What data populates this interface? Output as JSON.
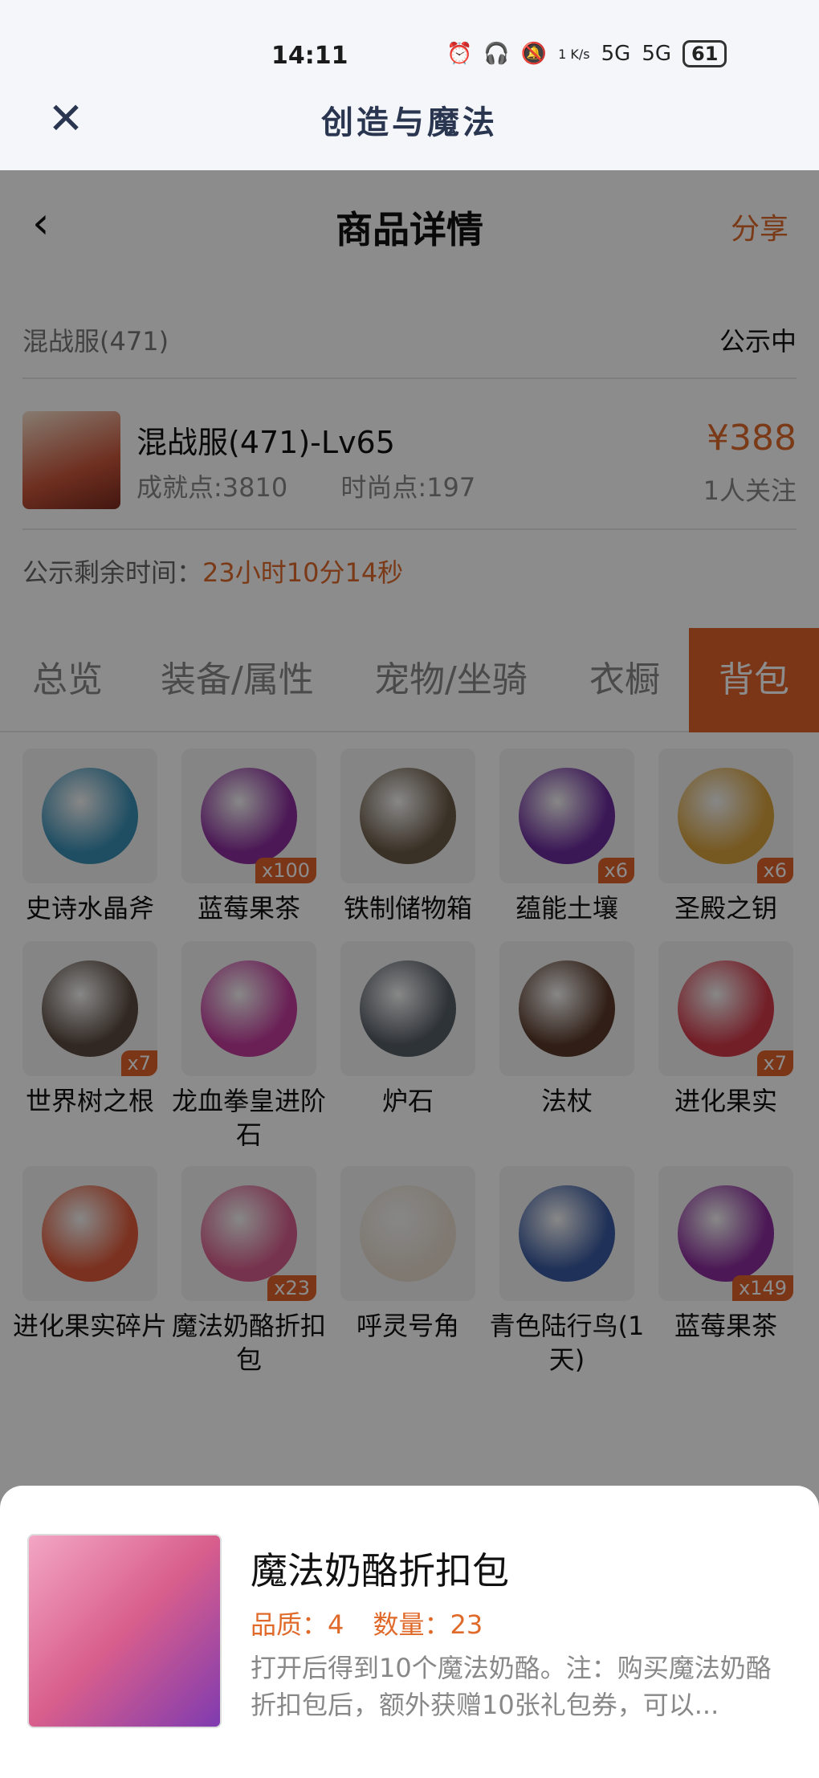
{
  "status_bar": {
    "time": "14:11",
    "net_speed": "1 K/s",
    "signal1": "5G",
    "signal2": "5G",
    "battery": "61"
  },
  "app_bar": {
    "title": "创造与魔法"
  },
  "header": {
    "title": "商品详情",
    "share": "分享"
  },
  "info": {
    "server": "混战服(471)",
    "status": "公示中"
  },
  "product": {
    "name": "混战服(471)-Lv65",
    "achievement": "成就点:3810",
    "fashion": "时尚点:197",
    "price": "¥388",
    "watchers": "1人关注"
  },
  "countdown": {
    "label": "公示剩余时间：",
    "value": "23小时10分14秒"
  },
  "tabs": [
    {
      "label": "总览"
    },
    {
      "label": "装备/属性"
    },
    {
      "label": "宠物/坐骑"
    },
    {
      "label": "衣橱"
    },
    {
      "label": "背包"
    }
  ],
  "items": [
    {
      "name": "史诗水晶斧",
      "badge": "",
      "color": "#3a8fb5"
    },
    {
      "name": "蓝莓果茶",
      "badge": "x100",
      "color": "#8a2c9c"
    },
    {
      "name": "铁制储物箱",
      "badge": "",
      "color": "#6b5a46"
    },
    {
      "name": "蕴能土壤",
      "badge": "x6",
      "color": "#6b2a9c"
    },
    {
      "name": "圣殿之钥",
      "badge": "x6",
      "color": "#d8a23c"
    },
    {
      "name": "世界树之根",
      "badge": "x7",
      "color": "#5a4a40"
    },
    {
      "name": "龙血拳皇进阶石",
      "badge": "",
      "color": "#c23a9c"
    },
    {
      "name": "炉石",
      "badge": "",
      "color": "#555d66"
    },
    {
      "name": "法杖",
      "badge": "",
      "color": "#5a3a2a"
    },
    {
      "name": "进化果实",
      "badge": "x7",
      "color": "#d23a4a"
    },
    {
      "name": "进化果实碎片",
      "badge": "",
      "color": "#e05a3a"
    },
    {
      "name": "魔法奶酪折扣包",
      "badge": "x23",
      "color": "#d85e8c"
    },
    {
      "name": "呼灵号角",
      "badge": "",
      "color": "#e8ddd0"
    },
    {
      "name": "青色陆行鸟(1天)",
      "badge": "",
      "color": "#3a5aa0"
    },
    {
      "name": "蓝莓果茶",
      "badge": "x149",
      "color": "#8a2c9c"
    }
  ],
  "sheet": {
    "title": "魔法奶酪折扣包",
    "quality": "品质：4",
    "quantity": "数量：23",
    "description": "打开后得到10个魔法奶酪。注：购买魔法奶酪折扣包后，额外获赠10张礼包券，可以..."
  }
}
